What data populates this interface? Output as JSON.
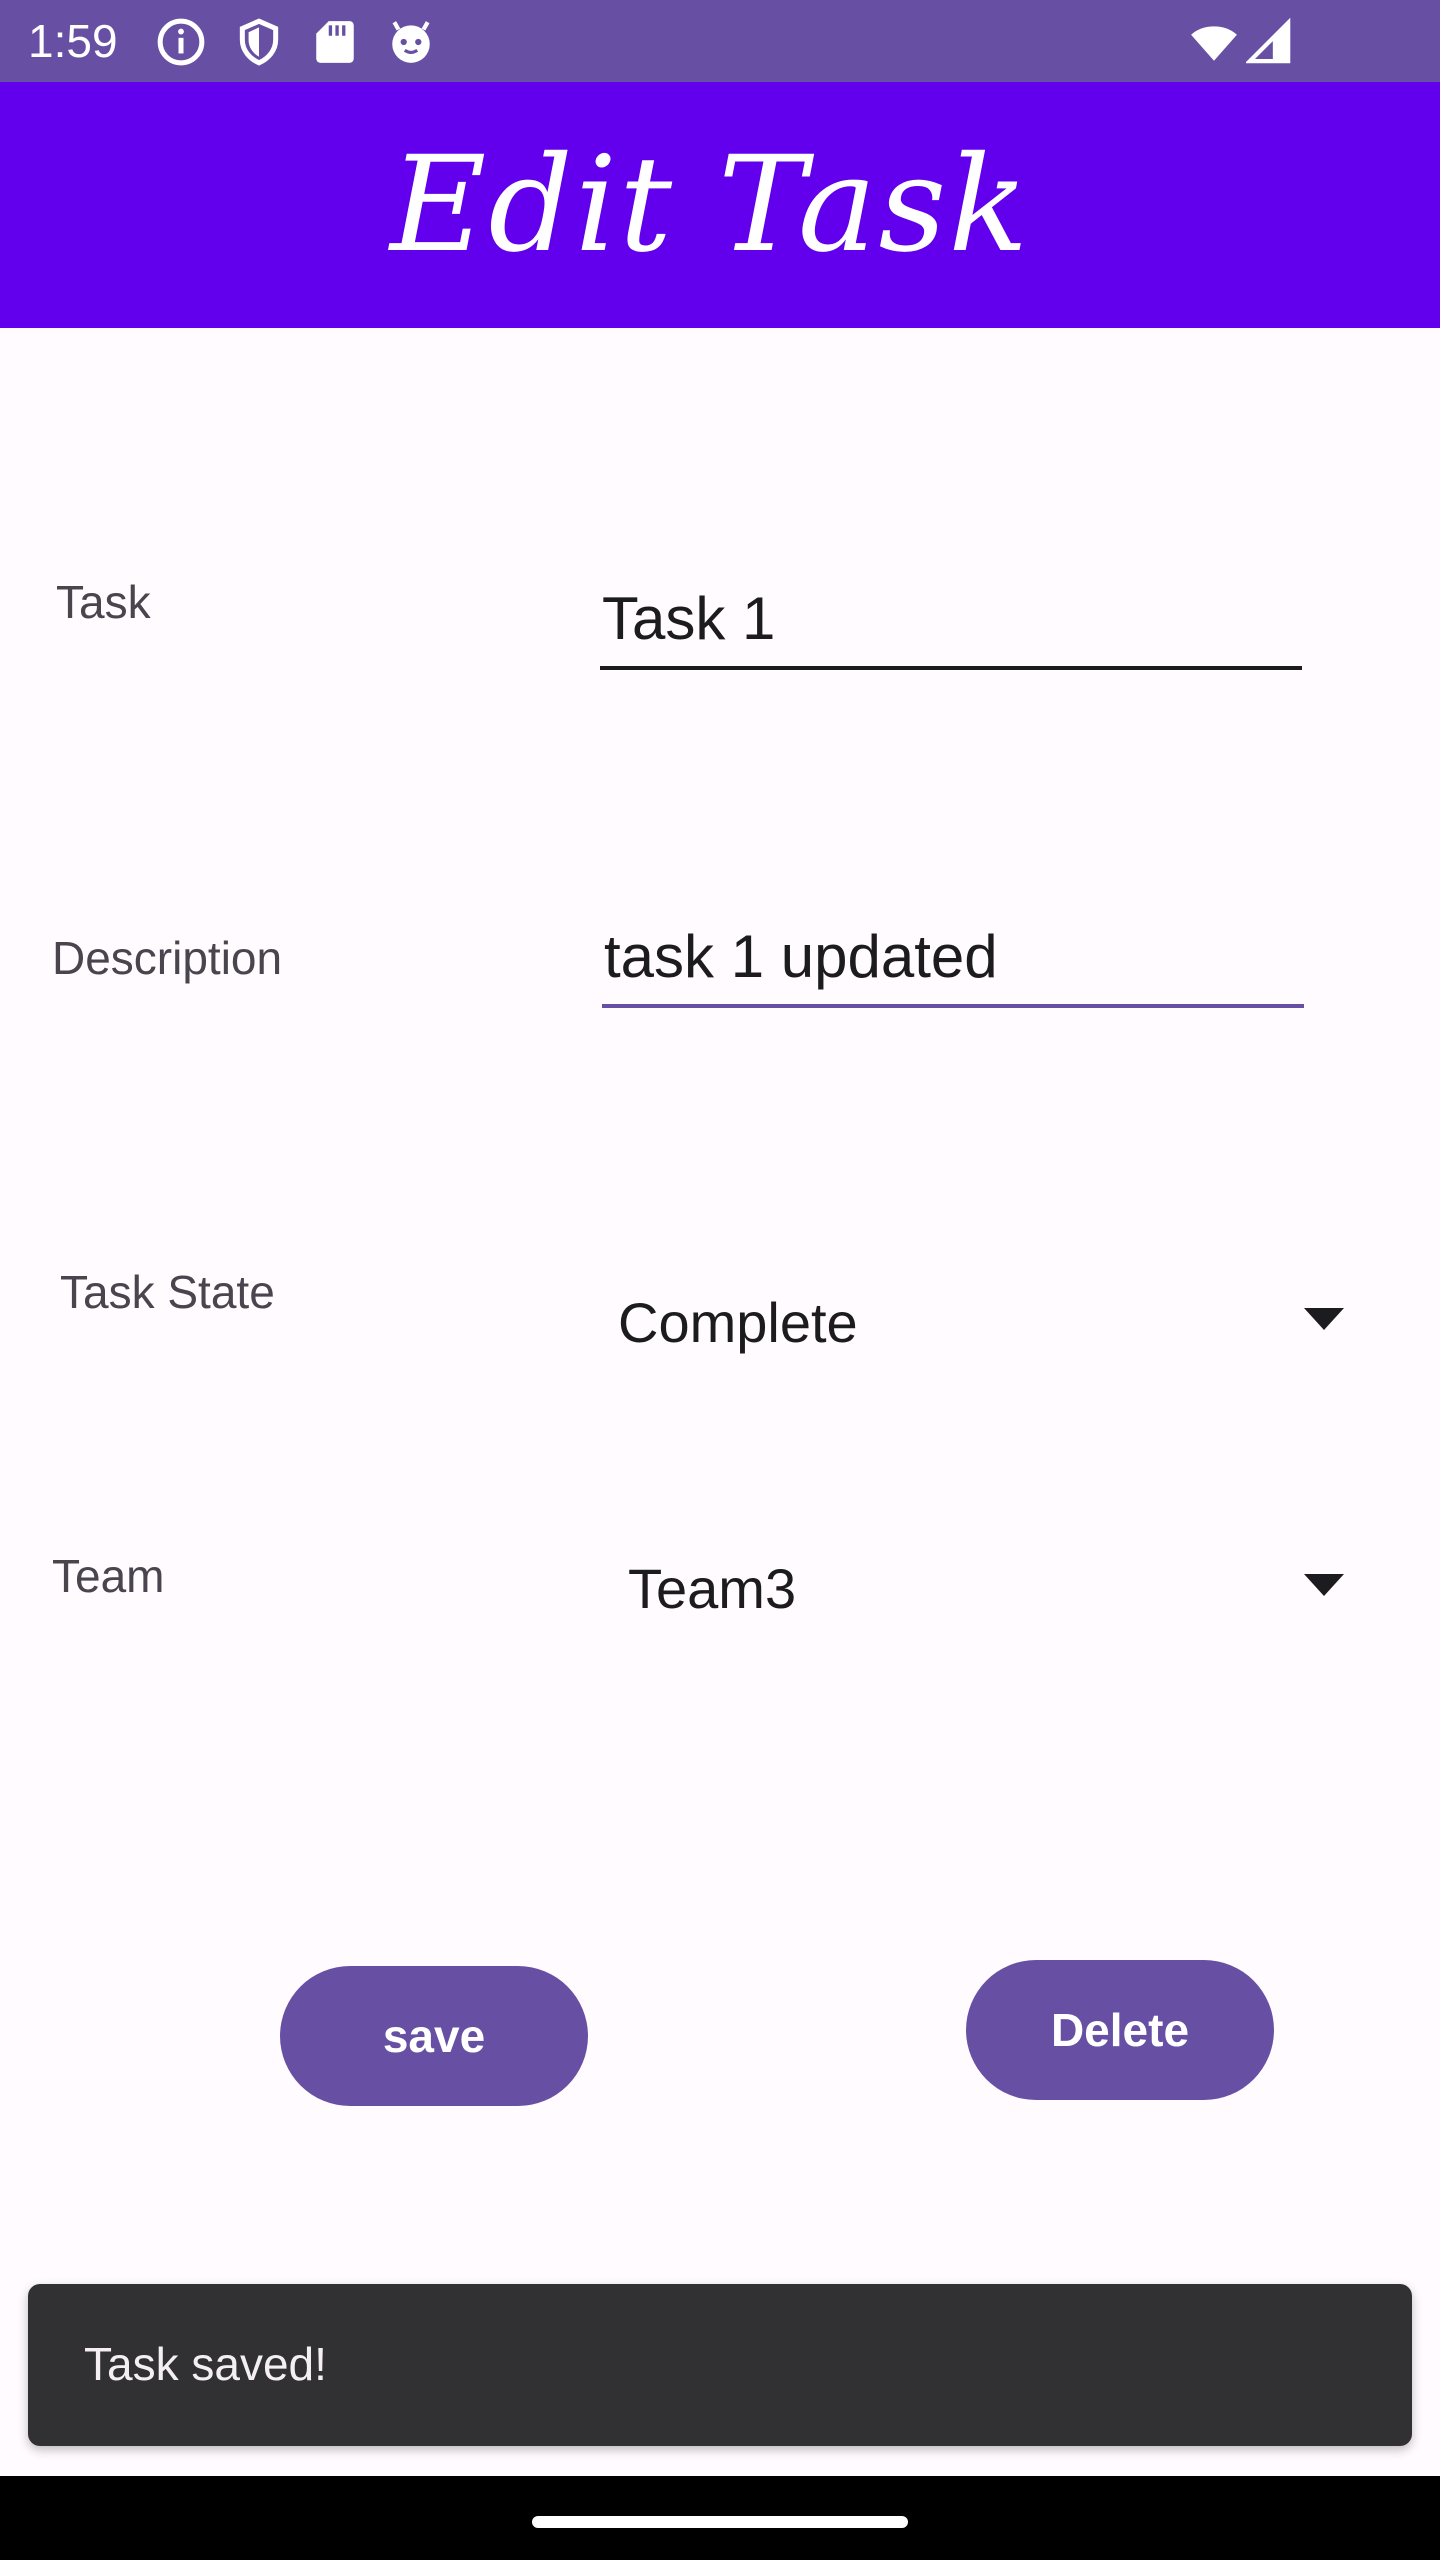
{
  "status_bar": {
    "time": "1:59",
    "icons": [
      "info-icon",
      "shield-icon",
      "sd-card-icon",
      "android-face-icon"
    ],
    "system_icons": [
      "wifi-icon",
      "cell-signal-icon"
    ]
  },
  "app_bar": {
    "title": "Edit Task"
  },
  "form": {
    "task": {
      "label": "Task",
      "value": "Task 1"
    },
    "description": {
      "label": "Description",
      "value": "task 1 updated"
    },
    "task_state": {
      "label": "Task State",
      "selected": "Complete"
    },
    "team": {
      "label": "Team",
      "selected": "Team3"
    }
  },
  "buttons": {
    "save_label": "save",
    "delete_label": "Delete"
  },
  "snackbar": {
    "message": "Task saved!"
  },
  "colors": {
    "status_bar": "#6750a4",
    "app_bar": "#6200ee",
    "button": "#6750a4",
    "snackbar": "#313033"
  }
}
